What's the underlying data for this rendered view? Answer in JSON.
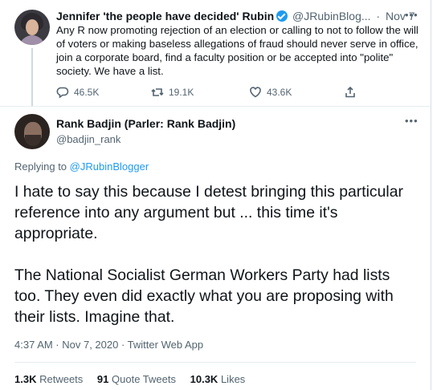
{
  "parent_tweet": {
    "name": "Jennifer 'the people have decided' Rubin",
    "handle": "@JRubinBlog...",
    "separator": "·",
    "date": "Nov 7",
    "more": "•••",
    "text": "Any R now promoting rejection of an election or calling to not to follow the will of voters or making baseless allegations of fraud should never serve in office, join a corporate board, find a faculty position or be accepted into \"polite\" society. We have a list.",
    "replies": "46.5K",
    "retweets": "19.1K",
    "likes": "43.6K"
  },
  "main_tweet": {
    "name": "Rank Badjin (Parler: Rank Badjin)",
    "handle": "@badjin_rank",
    "more": "•••",
    "replying_prefix": "Replying to",
    "replying_to": "@JRubinBlogger",
    "paragraph_1": "I hate to say this because I detest bringing this particular reference into any argument but ... this time it's appropriate.",
    "paragraph_2": "The National Socialist German Workers Party had lists too. They even did exactly what you are proposing with their lists. Imagine that.",
    "meta": "4:37 AM · Nov 7, 2020 · Twitter Web App",
    "stats": {
      "retweets_value": "1.3K",
      "retweets_label": "Retweets",
      "quote_value": "91",
      "quote_label": "Quote Tweets",
      "likes_value": "10.3K",
      "likes_label": "Likes"
    }
  },
  "colors": {
    "accent": "#1d9bf0",
    "text_primary": "#0f1419",
    "text_secondary": "#536471"
  },
  "icons": [
    "verified-badge-icon",
    "reply-icon",
    "retweet-icon",
    "like-icon",
    "share-icon",
    "more-icon"
  ]
}
